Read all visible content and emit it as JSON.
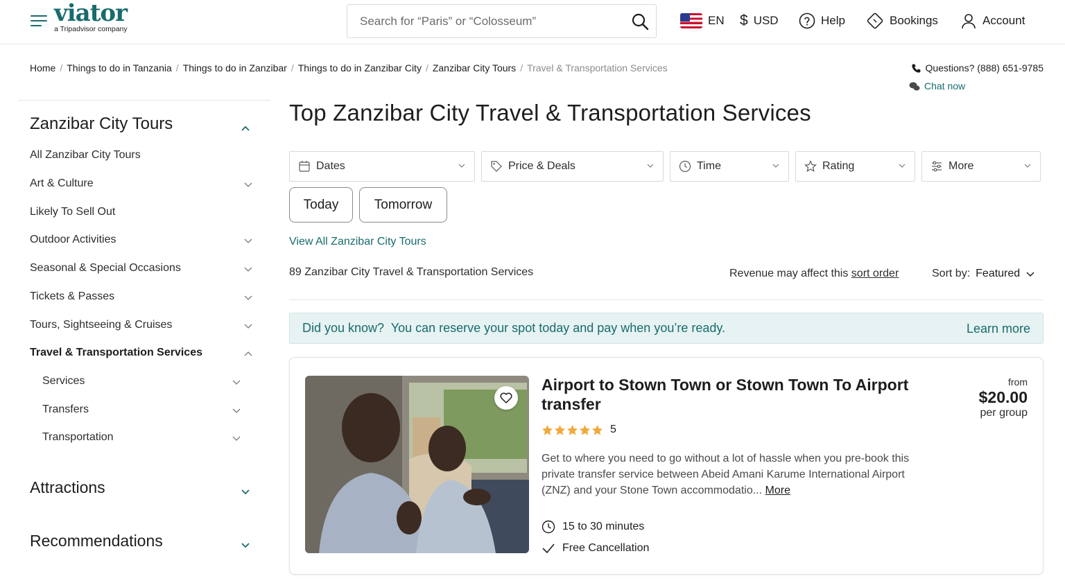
{
  "header": {
    "logo": "viator",
    "logo_sub": "a Tripadvisor company",
    "search_placeholder": "Search for “Paris” or “Colosseum”",
    "language": "EN",
    "currency": "USD",
    "help": "Help",
    "bookings": "Bookings",
    "account": "Account"
  },
  "breadcrumb": {
    "items": [
      "Home",
      "Things to do in Tanzania",
      "Things to do in Zanzibar",
      "Things to do in Zanzibar City",
      "Zanzibar City Tours"
    ],
    "current": "Travel & Transportation Services"
  },
  "contact": {
    "questions": "Questions? (888) 651-9785",
    "chat": "Chat now"
  },
  "sidebar": {
    "title": "Zanzibar City Tours",
    "items": [
      {
        "label": "All Zanzibar City Tours"
      },
      {
        "label": "Art & Culture"
      },
      {
        "label": "Likely To Sell Out"
      },
      {
        "label": "Outdoor Activities"
      },
      {
        "label": "Seasonal & Special Occasions"
      },
      {
        "label": "Tickets & Passes"
      },
      {
        "label": "Tours, Sightseeing & Cruises"
      },
      {
        "label": "Travel & Transportation Services"
      }
    ],
    "subitems": [
      {
        "label": "Services"
      },
      {
        "label": "Transfers"
      },
      {
        "label": "Transportation"
      }
    ],
    "sections": [
      {
        "label": "Attractions"
      },
      {
        "label": "Recommendations"
      }
    ]
  },
  "main": {
    "title": "Top Zanzibar City Travel & Transportation Services",
    "filters": [
      {
        "label": "Dates",
        "icon": "calendar-icon"
      },
      {
        "label": "Price & Deals",
        "icon": "tag-icon"
      },
      {
        "label": "Time",
        "icon": "clock-icon"
      },
      {
        "label": "Rating",
        "icon": "star-icon"
      },
      {
        "label": "More",
        "icon": "sliders-icon"
      }
    ],
    "quick_dates": [
      "Today",
      "Tomorrow"
    ],
    "view_all": "View All Zanzibar City Tours",
    "count_text": "89 Zanzibar City Travel & Transportation Services",
    "revenue_text": "Revenue may affect this ",
    "revenue_link": "sort order",
    "sort_label": "Sort by:",
    "sort_value": "Featured",
    "banner_text": "Did you know?  You can reserve your spot today and pay when you’re ready.",
    "banner_link": "Learn more"
  },
  "product": {
    "title": "Airport to Stown Town or Stown Town To Airport transfer",
    "rating": "5",
    "stars": 5,
    "description": "Get to where you need to go without a lot of hassle when you pre-book this private transfer service between Abeid Amani Karume International Airport (ZNZ) and your Stone Town accommodatio...",
    "more": "More",
    "duration": "15 to 30 minutes",
    "cancellation": "Free Cancellation",
    "price_from": "from",
    "price": "$20.00",
    "price_per": "per group"
  },
  "colors": {
    "brand": "#186b6d",
    "star": "#f2a93b",
    "banner_bg": "#e7f2f2"
  }
}
